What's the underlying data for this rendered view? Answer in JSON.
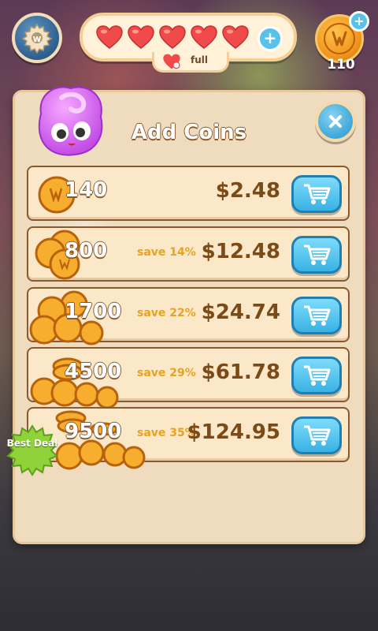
{
  "top_bar": {
    "lives_status": "full",
    "coin_balance": "110",
    "lives_count": 5
  },
  "dialog": {
    "title": "Add Coins",
    "offers": [
      {
        "amount": "140",
        "save": "",
        "price": "$2.48"
      },
      {
        "amount": "800",
        "save": "save 14%",
        "price": "$12.48"
      },
      {
        "amount": "1700",
        "save": "save 22%",
        "price": "$24.74"
      },
      {
        "amount": "4500",
        "save": "save 29%",
        "price": "$61.78"
      },
      {
        "amount": "9500",
        "save": "save 35%",
        "price": "$124.95"
      }
    ],
    "badge": "Best Deal"
  },
  "colors": {
    "accent_blue": "#39b2e4",
    "price_brown": "#7b4a16",
    "save_orange": "#e9a21e",
    "heart_red": "#f04a4a",
    "badge_green": "#8fd23a"
  }
}
